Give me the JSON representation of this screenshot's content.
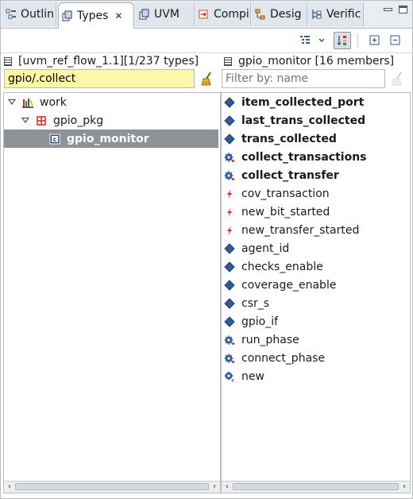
{
  "tabs": [
    {
      "label": "Outlin",
      "icon": "outline-icon",
      "active": false
    },
    {
      "label": "Types",
      "icon": "types-icon",
      "active": true,
      "close": "✕"
    },
    {
      "label": "UVM",
      "icon": "uvm-icon",
      "active": false
    },
    {
      "label": "Compi",
      "icon": "compile-order-icon",
      "active": false
    },
    {
      "label": "Desig",
      "icon": "design-hierarchy-icon",
      "active": false
    },
    {
      "label": "Verific",
      "icon": "verification-hierarchy-icon",
      "active": false
    }
  ],
  "left_pane": {
    "header": "[uvm_ref_flow_1.1][1/237 types]",
    "filter_value": "gpio/.collect",
    "tree": [
      {
        "label": "work",
        "icon": "library-icon"
      },
      {
        "label": "gpio_pkg",
        "icon": "package-icon"
      },
      {
        "label": "gpio_monitor",
        "icon": "class-icon",
        "selected": true
      }
    ]
  },
  "right_pane": {
    "header": "gpio_monitor [16 members]",
    "filter_placeholder": "Filter by: name",
    "members": [
      {
        "label": "item_collected_port",
        "icon": "field-icon",
        "bold": true
      },
      {
        "label": "last_trans_collected",
        "icon": "field-icon",
        "bold": true
      },
      {
        "label": "trans_collected",
        "icon": "field-icon",
        "bold": true
      },
      {
        "label": "collect_transactions",
        "icon": "task-icon",
        "bold": true
      },
      {
        "label": "collect_transfer",
        "icon": "task-icon",
        "bold": true
      },
      {
        "label": "cov_transaction",
        "icon": "event-icon",
        "bold": false
      },
      {
        "label": "new_bit_started",
        "icon": "event-icon",
        "bold": false
      },
      {
        "label": "new_transfer_started",
        "icon": "event-icon",
        "bold": false
      },
      {
        "label": "agent_id",
        "icon": "field-icon",
        "bold": false
      },
      {
        "label": "checks_enable",
        "icon": "field-icon",
        "bold": false
      },
      {
        "label": "coverage_enable",
        "icon": "field-icon",
        "bold": false
      },
      {
        "label": "csr_s",
        "icon": "field-icon",
        "bold": false
      },
      {
        "label": "gpio_if",
        "icon": "field-icon",
        "bold": false
      },
      {
        "label": "run_phase",
        "icon": "task-icon",
        "bold": false
      },
      {
        "label": "connect_phase",
        "icon": "task-icon",
        "bold": false
      },
      {
        "label": "new",
        "icon": "constructor-icon",
        "bold": false
      }
    ]
  },
  "colors": {
    "field": "#2d5c9e",
    "task": "#2d5c9e",
    "event": "#d8261f",
    "filter_active_bg": "#fdf7a8",
    "selection_bg": "#8e9398"
  }
}
